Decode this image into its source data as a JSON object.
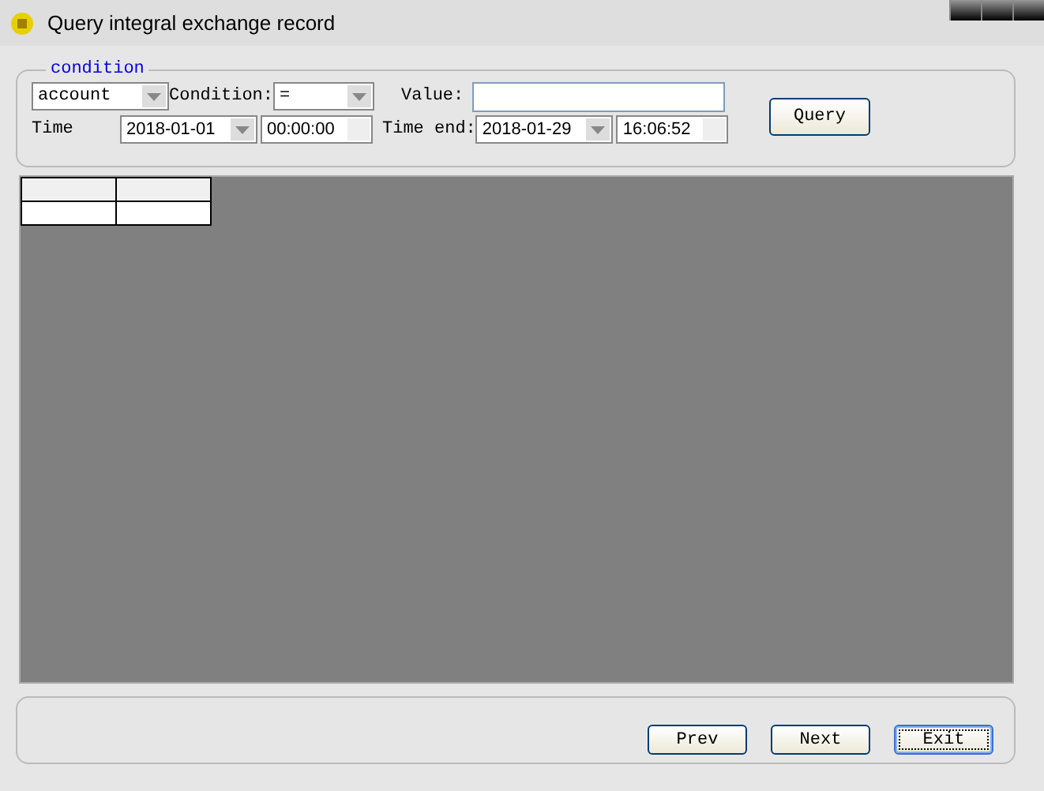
{
  "window": {
    "title": "Query integral exchange record"
  },
  "condition": {
    "legend": "condition",
    "field": {
      "value": "account"
    },
    "condition_label": "Condition:",
    "operator": {
      "value": "="
    },
    "value_label": "Value:",
    "time_start_label": "Time",
    "start_date": "2018-01-01",
    "start_time": "00:00:00",
    "time_end_label": "Time end:",
    "end_date": "2018-01-29",
    "end_time": "16:06:52",
    "query_button": "Query"
  },
  "buttons": [
    {
      "label": "Prev",
      "focused": false
    },
    {
      "label": "Next",
      "focused": false
    },
    {
      "label": "Exit",
      "focused": true
    }
  ]
}
